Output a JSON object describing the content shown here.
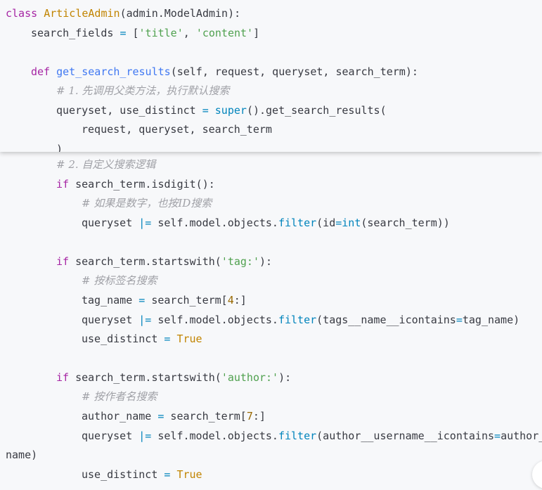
{
  "code": {
    "l1": {
      "kw": "class",
      "cls": "ArticleAdmin",
      "rest": "(admin.ModelAdmin):"
    },
    "l2": {
      "a": "search_fields ",
      "eq": "=",
      "b": " [",
      "s1": "'title'",
      "c": ", ",
      "s2": "'content'",
      "d": "]"
    },
    "l4": {
      "kw": "def",
      "fn": "get_search_results",
      "rest": "(self, request, queryset, search_term):"
    },
    "l5": {
      "comment": "# 1. 先调用父类方法，执行默认搜索"
    },
    "l6": {
      "a": "queryset, use_distinct ",
      "eq": "=",
      "sp": " ",
      "blt": "super",
      "b": "().get_search_results("
    },
    "l7": {
      "text": "request, queryset, search_term"
    },
    "l8": {
      "text": ")"
    },
    "l9": {
      "comment": "# 2. 自定义搜索逻辑"
    },
    "l10": {
      "kw": "if",
      "rest": " search_term.isdigit():"
    },
    "l11": {
      "comment": "# 如果是数字，也按ID搜索"
    },
    "l12": {
      "a": "queryset ",
      "op": "|=",
      "b": " self.model.objects.",
      "blt": "filter",
      "c": "(id",
      "eq": "=",
      "blt2": "int",
      "d": "(search_term))"
    },
    "l14": {
      "kw": "if",
      "a": " search_term.startswith(",
      "str": "'tag:'",
      "b": "):"
    },
    "l15": {
      "comment": "# 按标签名搜索"
    },
    "l16": {
      "a": "tag_name ",
      "eq": "=",
      "b": " search_term[",
      "num": "4",
      "c": ":]"
    },
    "l17": {
      "a": "queryset ",
      "op": "|=",
      "b": " self.model.objects.",
      "blt": "filter",
      "c": "(tags__name__icontains",
      "eq": "=",
      "d": "tag_name)"
    },
    "l18": {
      "a": "use_distinct ",
      "eq": "=",
      "sp": " ",
      "bool": "True"
    },
    "l20": {
      "kw": "if",
      "a": " search_term.startswith(",
      "str": "'author:'",
      "b": "):"
    },
    "l21": {
      "comment": "# 按作者名搜索"
    },
    "l22": {
      "a": "author_name ",
      "eq": "=",
      "b": " search_term[",
      "num": "7",
      "c": ":]"
    },
    "l23": {
      "a": "queryset ",
      "op": "|=",
      "b": " self.model.objects.",
      "blt": "filter",
      "c": "(author__username__icontains",
      "eq": "=",
      "d": "author_"
    },
    "l24": {
      "text": "name)"
    },
    "l25": {
      "a": "use_distinct ",
      "eq": "=",
      "sp": " ",
      "bool": "True"
    }
  }
}
